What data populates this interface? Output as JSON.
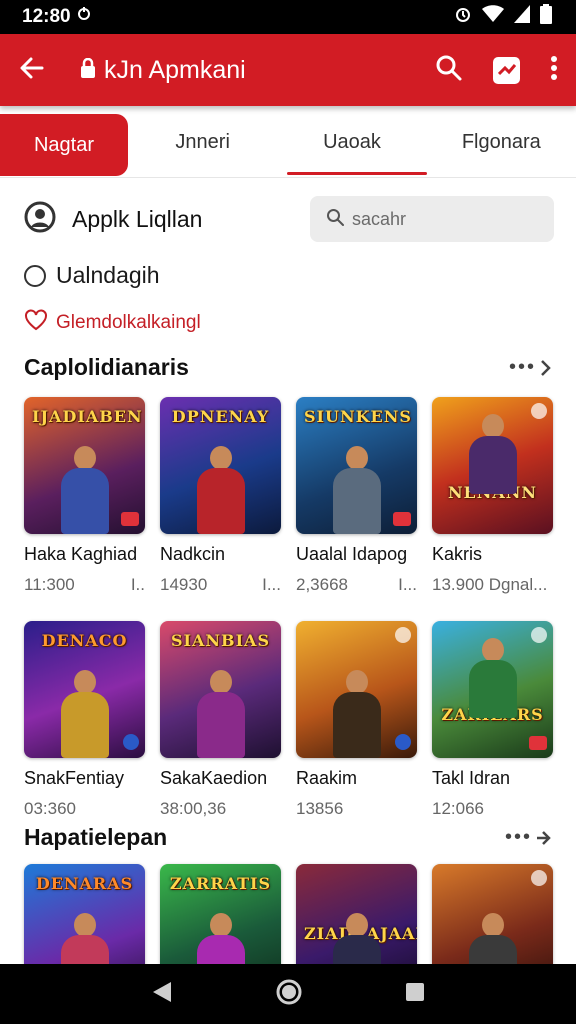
{
  "status_bar": {
    "time": "12:80"
  },
  "app_bar": {
    "title": "kJn Apmkani"
  },
  "tabs": [
    {
      "label": "Nagtar"
    },
    {
      "label": "Jnneri"
    },
    {
      "label": "Uaoak"
    },
    {
      "label": "Flgonara"
    }
  ],
  "profile": {
    "name": "Applk Liqllan"
  },
  "search": {
    "placeholder": "sacahr"
  },
  "radio_option": {
    "label": "Ualndagih"
  },
  "favorite": {
    "label": "Glemdolkalkaingl"
  },
  "sections": [
    {
      "title": "Caplolidianaris",
      "items": [
        {
          "name": "Haka Kaghiad",
          "meta1": "11:300",
          "meta2": "I..",
          "logo": "IJADIABEN"
        },
        {
          "name": "Nadkcin",
          "meta1": "14930",
          "meta2": "I...",
          "logo": "DPNENAY"
        },
        {
          "name": "Uaalal Idapog",
          "meta1": "2,3668",
          "meta2": "I...",
          "logo": "SIUNKENS"
        },
        {
          "name": "Kakris",
          "meta1": "13.900 Dgnal...",
          "meta2": "",
          "logo": "NENANN"
        },
        {
          "name": "SnakFentiay",
          "meta1": "03:360",
          "meta2": "",
          "logo": "DENACO"
        },
        {
          "name": "SakaKaedion",
          "meta1": "38:00,36",
          "meta2": "",
          "logo": "SIANBIAS"
        },
        {
          "name": "Raakim",
          "meta1": "13856",
          "meta2": "",
          "logo": ""
        },
        {
          "name": "Takl Idran",
          "meta1": "12:066",
          "meta2": "",
          "logo": "ZARIEARS"
        }
      ]
    },
    {
      "title": "Hapatielepan",
      "items": [
        {
          "logo": "DENARAS"
        },
        {
          "logo": "ZARRATIS"
        },
        {
          "logo": "ZIADEAJAAI"
        },
        {
          "logo": ""
        }
      ]
    }
  ]
}
